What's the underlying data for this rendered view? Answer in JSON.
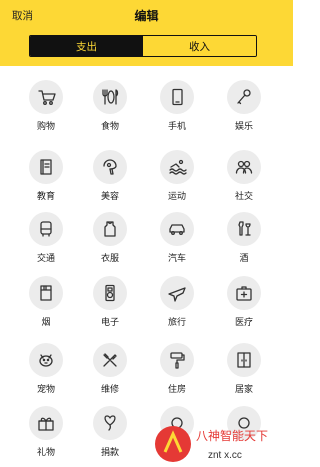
{
  "header": {
    "cancel_label": "取消",
    "title": "编辑"
  },
  "tabs": [
    {
      "label": "支出",
      "active": true
    },
    {
      "label": "收入",
      "active": false
    }
  ],
  "categories": [
    {
      "label": "购物",
      "icon": "shopping-cart-icon"
    },
    {
      "label": "食物",
      "icon": "food-icon"
    },
    {
      "label": "手机",
      "icon": "phone-icon"
    },
    {
      "label": "娱乐",
      "icon": "microphone-icon"
    },
    {
      "label": "教育",
      "icon": "book-icon"
    },
    {
      "label": "美容",
      "icon": "hair-dryer-icon"
    },
    {
      "label": "运动",
      "icon": "swimming-icon"
    },
    {
      "label": "社交",
      "icon": "people-icon"
    },
    {
      "label": "交通",
      "icon": "bus-icon"
    },
    {
      "label": "衣服",
      "icon": "shirt-icon"
    },
    {
      "label": "汽车",
      "icon": "car-icon"
    },
    {
      "label": "酒",
      "icon": "wine-icon"
    },
    {
      "label": "烟",
      "icon": "cigarette-pack-icon"
    },
    {
      "label": "电子",
      "icon": "electronics-icon"
    },
    {
      "label": "旅行",
      "icon": "airplane-icon"
    },
    {
      "label": "医疗",
      "icon": "medical-kit-icon"
    },
    {
      "label": "宠物",
      "icon": "pet-icon"
    },
    {
      "label": "维修",
      "icon": "tools-icon"
    },
    {
      "label": "住房",
      "icon": "paint-roller-icon"
    },
    {
      "label": "居家",
      "icon": "cabinet-icon"
    },
    {
      "label": "礼物",
      "icon": "gift-icon"
    },
    {
      "label": "捐款",
      "icon": "heart-balloon-icon"
    },
    {
      "label": "",
      "icon": "partial-icon"
    },
    {
      "label": "",
      "icon": "partial-icon"
    }
  ],
  "watermark": {
    "text": "八神智能天下",
    "url": "znt x.cc"
  },
  "colors": {
    "header_bg": "#fdd835",
    "active_tab_bg": "#111111",
    "active_tab_text": "#fdd835",
    "icon_bg": "#ececec"
  }
}
